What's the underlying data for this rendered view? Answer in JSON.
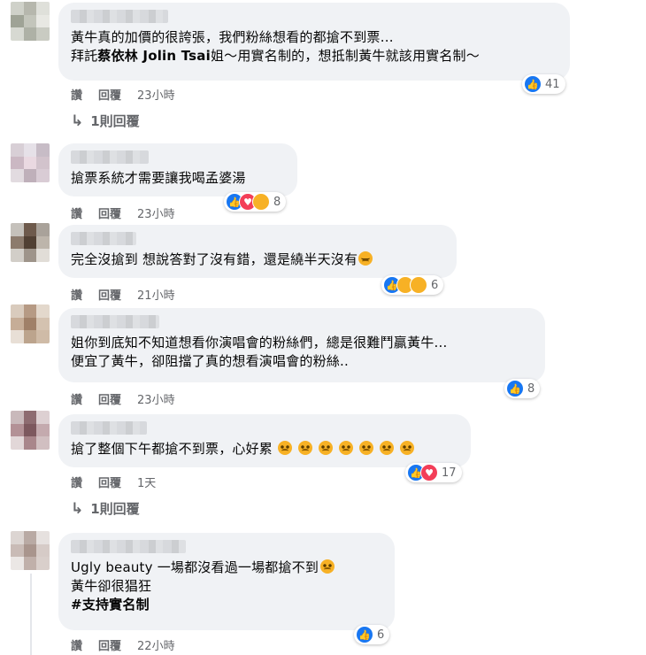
{
  "labels": {
    "like": "讚",
    "reply": "回覆"
  },
  "comments": [
    {
      "lines": [
        "黃牛真的加價的很誇張，我們粉絲想看的都搶不到票…",
        [
          "拜託",
          "蔡依林 Jolin Tsai",
          "姐～用實名制的，想抵制黃牛就該用實名制～"
        ]
      ],
      "time": "23小時",
      "reactions": {
        "types": [
          "like"
        ],
        "count": "41"
      },
      "replies": "1則回覆",
      "avatar_colors": [
        "#cfd1c9",
        "#b6b7ad",
        "#dfe0da",
        "#9fa396",
        "#c3c5bb",
        "#e8e8e3",
        "#d7d9d2",
        "#aeb1a6",
        "#c9cbc2"
      ]
    },
    {
      "lines": [
        "搶票系統才需要讓我喝孟婆湯"
      ],
      "time": "23小時",
      "reactions": {
        "types": [
          "like",
          "love",
          "sad"
        ],
        "count": "8"
      },
      "avatar_colors": [
        "#d8cfd6",
        "#e6e1e8",
        "#c7bcc6",
        "#cbb8c3",
        "#ead9e1",
        "#d2c3cc",
        "#e2dbe0",
        "#bfb0ba",
        "#d9ccd5"
      ]
    },
    {
      "lines": [
        "完全沒搶到 想說答對了沒有錯，還是繞半天沒有"
      ],
      "time": "21小時",
      "reactions": {
        "types": [
          "like",
          "haha",
          "sad"
        ],
        "count": "6"
      },
      "avatar_colors": [
        "#c5c1bb",
        "#6e5a4c",
        "#a9a29a",
        "#8c7b6d",
        "#514033",
        "#bdb5ab",
        "#d2cec8",
        "#9e948a",
        "#e1ddd7"
      ]
    },
    {
      "lines": [
        "姐你到底知不知道想看你演唱會的粉絲們，總是很難鬥贏黃牛…",
        "便宜了黃牛，卻阻擋了真的想看演唱會的粉絲.."
      ],
      "time": "23小時",
      "reactions": {
        "types": [
          "like"
        ],
        "count": "8"
      },
      "avatar_colors": [
        "#d9cbbd",
        "#b69a84",
        "#e3d8cc",
        "#c6ad97",
        "#a08068",
        "#d4c2b0",
        "#e8dfd6",
        "#bca48d",
        "#cfbba7"
      ]
    },
    {
      "lines": [
        "搶了整個下午都搶不到票，心好累"
      ],
      "time": "1天",
      "reactions": {
        "types": [
          "like",
          "love"
        ],
        "count": "17"
      },
      "replies": "1則回覆",
      "avatar_colors": [
        "#c9b9bb",
        "#8e6c71",
        "#ddd0d2",
        "#b39196",
        "#7d585e",
        "#c4aaae",
        "#e2d7d8",
        "#a9868b",
        "#d1bfc1"
      ]
    },
    {
      "lines": [
        "Ugly beauty 一場都沒看過一場都搶不到",
        "黃牛卻很猖狂",
        "#支持實名制"
      ],
      "time": "22小時",
      "reactions": {
        "types": [
          "like"
        ],
        "count": "6"
      },
      "avatar_colors": [
        "#dcd5d2",
        "#b9aaa4",
        "#e6e1df",
        "#c9bbb6",
        "#a9958d",
        "#d6cbc7",
        "#ebe7e5",
        "#c0b0aa",
        "#d9cfcb"
      ]
    }
  ]
}
